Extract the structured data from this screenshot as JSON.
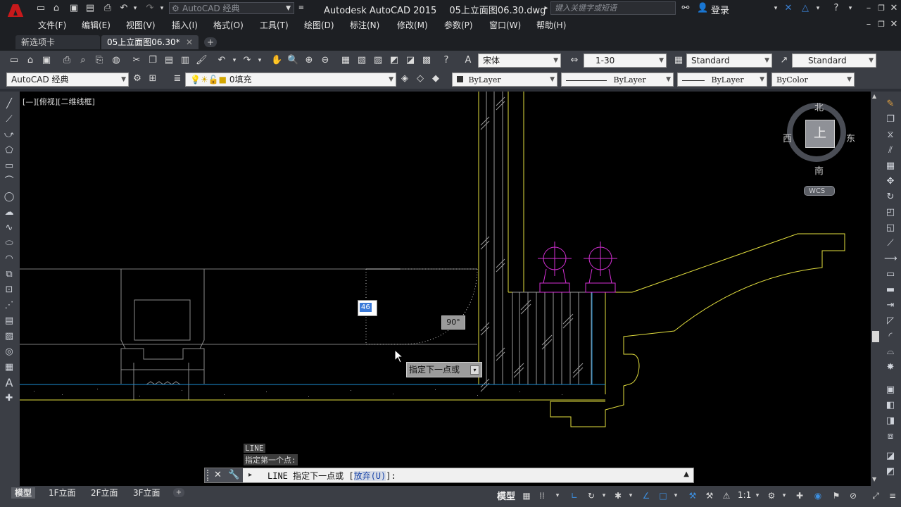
{
  "app": {
    "title": "Autodesk AutoCAD 2015",
    "file": "05上立面图06.30.dwg",
    "workspace_selector": "AutoCAD 经典",
    "search_placeholder": "键入关键字或短语",
    "login_label": "登录"
  },
  "menu": [
    "文件(F)",
    "编辑(E)",
    "视图(V)",
    "插入(I)",
    "格式(O)",
    "工具(T)",
    "绘图(D)",
    "标注(N)",
    "修改(M)",
    "参数(P)",
    "窗口(W)",
    "帮助(H)"
  ],
  "doc_tabs": [
    {
      "label": "新选项卡",
      "active": false
    },
    {
      "label": "05上立面图06.30*",
      "active": true
    }
  ],
  "toolbar1": {
    "text_style": "宋体",
    "dim_scale": "1-30",
    "dim_style": "Standard",
    "table_style": "Standard"
  },
  "toolbar2": {
    "workspace": "AutoCAD 经典",
    "layer": "0填充",
    "color": "ByLayer",
    "linetype": "ByLayer",
    "lineweight": "ByLayer",
    "plotstyle": "ByColor"
  },
  "viewport": {
    "label": "[—][俯视][二维线框]"
  },
  "viewcube": {
    "north": "北",
    "south": "南",
    "west": "西",
    "east": "东",
    "face": "上",
    "wcs": "WCS"
  },
  "dynamic_input": {
    "distance_value": "46",
    "angle": "90°",
    "prompt": "指定下一点或"
  },
  "command": {
    "history": [
      "LINE",
      "指定第一个点:"
    ],
    "current_prefix": "LINE 指定下一点或 [",
    "option": "放弃(U)",
    "suffix": "]:"
  },
  "layout_tabs": [
    "模型",
    "1F立面",
    "2F立面",
    "3F立面"
  ],
  "status": {
    "model_label": "模型",
    "annotation_scale": "1:1"
  },
  "colors": {
    "accent_blue": "#2b7fd8",
    "geometry_yellow": "#e3df3e",
    "geometry_magenta": "#d62fd6",
    "geometry_grey": "#8a8a8a",
    "geometry_cyan": "#1b8fd6",
    "logo_red": "#c8191b"
  }
}
